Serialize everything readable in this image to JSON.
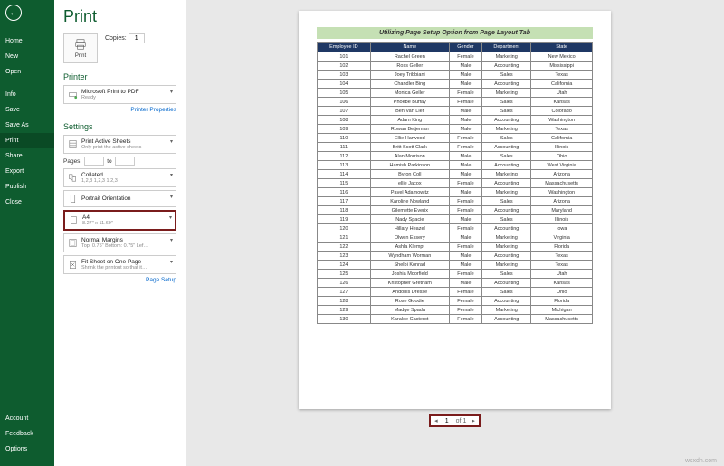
{
  "title": "Print",
  "sidebar": {
    "back": "←",
    "top": [
      "Home",
      "New",
      "Open"
    ],
    "mid": [
      "Info",
      "Save",
      "Save As",
      "Print",
      "Share",
      "Export",
      "Publish",
      "Close"
    ],
    "bot": [
      "Account",
      "Feedback",
      "Options"
    ]
  },
  "printbtn": "Print",
  "copies_lbl": "Copies:",
  "copies_val": "1",
  "printer_h": "Printer",
  "printer": {
    "name": "Microsoft Print to PDF",
    "status": "Ready"
  },
  "printer_props": "Printer Properties",
  "settings_h": "Settings",
  "s_sheets": {
    "t": "Print Active Sheets",
    "s": "Only print the active sheets"
  },
  "pages_lbl": "Pages:",
  "pages_to": "to",
  "s_collate": {
    "t": "Collated",
    "s": "1,2,3  1,2,3  1,2,3"
  },
  "s_orient": {
    "t": "Portrait Orientation",
    "s": ""
  },
  "s_paper": {
    "t": "A4",
    "s": "8.27\" x 11.69\""
  },
  "s_margin": {
    "t": "Normal Margins",
    "s": "Top: 0.75\" Bottom: 0.75\" Lef…"
  },
  "s_scale": {
    "t": "Fit Sheet on One Page",
    "s": "Shrink the printout so that it…"
  },
  "page_setup": "Page Setup",
  "pager_cur": "1",
  "pager_of": "of 1",
  "watermark": "wsxdn.com",
  "table": {
    "title": "Utilizing Page Setup Option from Page Layout Tab",
    "headers": [
      "Employee ID",
      "Name",
      "Gender",
      "Department",
      "State"
    ],
    "rows": [
      [
        "101",
        "Rachel Green",
        "Female",
        "Marketing",
        "New Mexico"
      ],
      [
        "102",
        "Ross Geller",
        "Male",
        "Accounting",
        "Mississippi"
      ],
      [
        "103",
        "Joey Tribbiani",
        "Male",
        "Sales",
        "Texas"
      ],
      [
        "104",
        "Chandler Bing",
        "Male",
        "Accounting",
        "California"
      ],
      [
        "105",
        "Monica Geller",
        "Female",
        "Marketing",
        "Utah"
      ],
      [
        "106",
        "Phoebe Buffay",
        "Female",
        "Sales",
        "Kansas"
      ],
      [
        "107",
        "Ben Van Lier",
        "Male",
        "Sales",
        "Colorado"
      ],
      [
        "108",
        "Adam King",
        "Male",
        "Accounting",
        "Washington"
      ],
      [
        "109",
        "Rowan Betjeman",
        "Male",
        "Marketing",
        "Texas"
      ],
      [
        "110",
        "Ellie Harwood",
        "Female",
        "Sales",
        "California"
      ],
      [
        "111",
        "Britt Scott Clark",
        "Female",
        "Accounting",
        "Illinois"
      ],
      [
        "112",
        "Alan Morrison",
        "Male",
        "Sales",
        "Ohio"
      ],
      [
        "113",
        "Hamish Parkinson",
        "Male",
        "Accounting",
        "West Virginia"
      ],
      [
        "114",
        "Byron Coll",
        "Male",
        "Marketing",
        "Arizona"
      ],
      [
        "115",
        "ellie Jacox",
        "Female",
        "Accounting",
        "Massachusetts"
      ],
      [
        "116",
        "Pavel Adamowitz",
        "Male",
        "Marketing",
        "Washington"
      ],
      [
        "117",
        "Karoline Nowland",
        "Female",
        "Sales",
        "Arizona"
      ],
      [
        "118",
        "Gilemette Everix",
        "Female",
        "Accounting",
        "Maryland"
      ],
      [
        "119",
        "Nady Spacie",
        "Male",
        "Sales",
        "Illinois"
      ],
      [
        "120",
        "Hillary Heazel",
        "Female",
        "Accounting",
        "Iowa"
      ],
      [
        "121",
        "Olwen Essery",
        "Male",
        "Marketing",
        "Virginia"
      ],
      [
        "122",
        "Ashla Klempt",
        "Female",
        "Marketing",
        "Florida"
      ],
      [
        "123",
        "Wyndham Worman",
        "Male",
        "Accounting",
        "Texas"
      ],
      [
        "124",
        "Shelbi Konrad",
        "Male",
        "Marketing",
        "Texas"
      ],
      [
        "125",
        "Joshia Moorfield",
        "Female",
        "Sales",
        "Utah"
      ],
      [
        "126",
        "Kristopher Gretham",
        "Male",
        "Accounting",
        "Kansas"
      ],
      [
        "127",
        "Andonis Dresse",
        "Female",
        "Sales",
        "Ohio"
      ],
      [
        "128",
        "Rose Goodie",
        "Female",
        "Accounting",
        "Florida"
      ],
      [
        "129",
        "Madge Spada",
        "Female",
        "Marketing",
        "Michigan"
      ],
      [
        "130",
        "Karalee Casterot",
        "Female",
        "Accounting",
        "Massachusetts"
      ]
    ]
  }
}
